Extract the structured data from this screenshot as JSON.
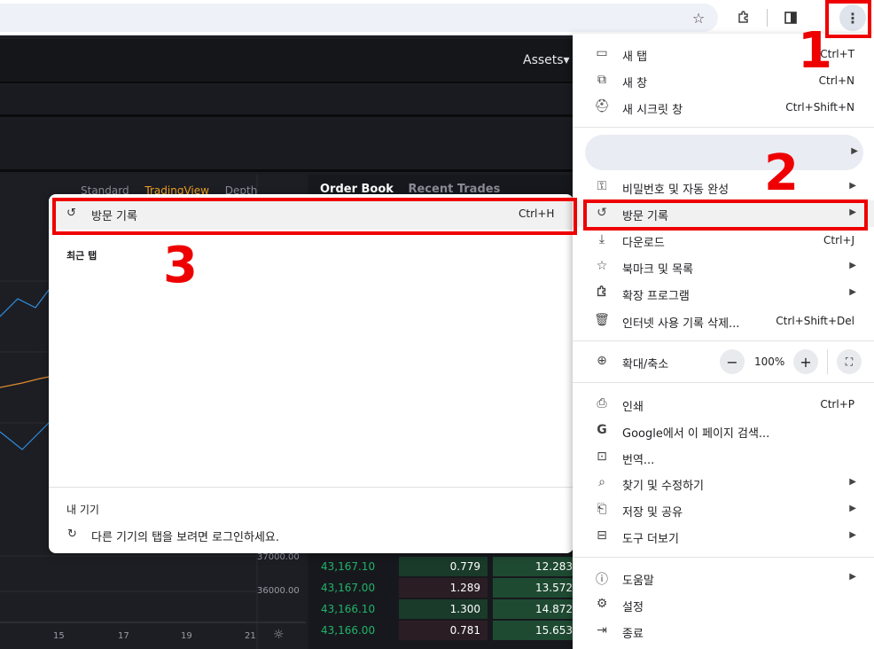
{
  "trading": {
    "assets_label": "Assets▾",
    "chart_tabs": [
      "Standard",
      "TradingView",
      "Depth"
    ],
    "orderbook_tabs": [
      "Order Book",
      "Recent Trades"
    ],
    "y_axis": [
      "37000.00",
      "36000.00"
    ],
    "x_axis": [
      "15",
      "17",
      "19",
      "21"
    ],
    "orderbook_rows": [
      {
        "price": "43,167.10",
        "amount": "0.779",
        "total": "12.283"
      },
      {
        "price": "43,167.00",
        "amount": "1.289",
        "total": "13.572"
      },
      {
        "price": "43,166.10",
        "amount": "1.300",
        "total": "14.872"
      },
      {
        "price": "43,166.00",
        "amount": "0.781",
        "total": "15.653"
      }
    ]
  },
  "history_panel": {
    "history_label": "방문 기록",
    "history_shortcut": "Ctrl+H",
    "recent_tabs_label": "최근 탭",
    "my_devices_label": "내 기기",
    "signin_text": "다른 기기의 탭을 보려면 로그인하세요."
  },
  "main_menu": {
    "new_tab": {
      "label": "새 탭",
      "shortcut": "Ctrl+T"
    },
    "new_window": {
      "label": "새 창",
      "shortcut": "Ctrl+N"
    },
    "incognito": {
      "label": "새 시크릿 창",
      "shortcut": "Ctrl+Shift+N"
    },
    "passwords": {
      "label": "비밀번호 및 자동 완성"
    },
    "history": {
      "label": "방문 기록"
    },
    "downloads": {
      "label": "다운로드",
      "shortcut": "Ctrl+J"
    },
    "bookmarks": {
      "label": "북마크 및 목록"
    },
    "extensions": {
      "label": "확장 프로그램"
    },
    "clear_data": {
      "label": "인터넷 사용 기록 삭제...",
      "shortcut": "Ctrl+Shift+Del"
    },
    "zoom": {
      "label": "확대/축소",
      "minus": "−",
      "value": "100%",
      "plus": "+"
    },
    "print": {
      "label": "인쇄",
      "shortcut": "Ctrl+P"
    },
    "search_google": {
      "label": "Google에서 이 페이지 검색..."
    },
    "translate": {
      "label": "번역..."
    },
    "find_edit": {
      "label": "찾기 및 수정하기"
    },
    "save_share": {
      "label": "저장 및 공유"
    },
    "more_tools": {
      "label": "도구 더보기"
    },
    "help": {
      "label": "도움말"
    },
    "settings": {
      "label": "설정"
    },
    "exit": {
      "label": "종료"
    }
  },
  "annotations": {
    "n1": "1",
    "n2": "2",
    "n3": "3"
  },
  "colors": {
    "annotation_red": "#ef0000",
    "price_green": "#1fb46a",
    "tradingview_active": "#f0a020"
  }
}
